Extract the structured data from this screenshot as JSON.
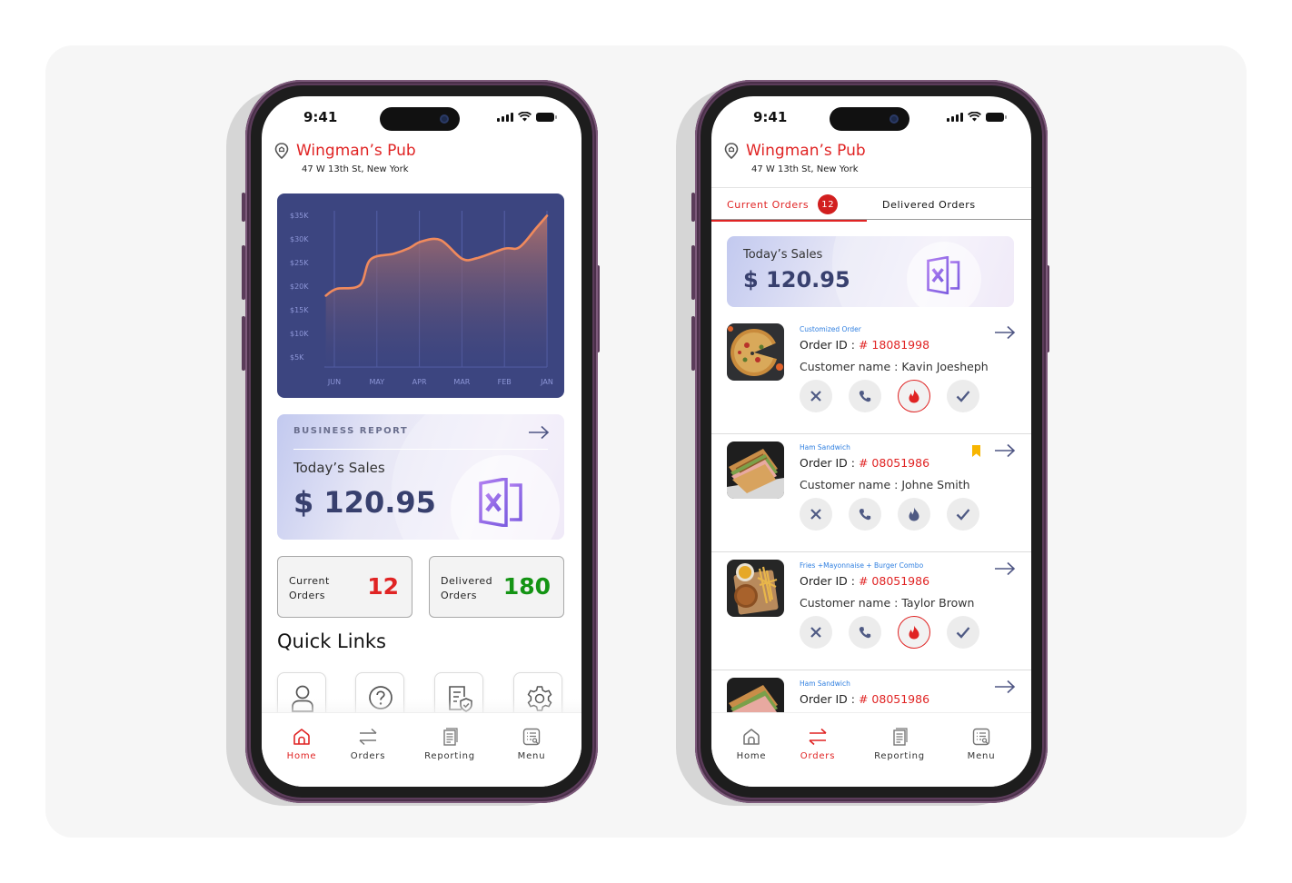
{
  "colors": {
    "brand_red": "#e02424",
    "success_green": "#149414",
    "chart_bg": "#3c4580",
    "chart_line": "#f08a5d",
    "link_blue": "#2f7fe0",
    "bookmark_yellow": "#f7b500",
    "indigo_text": "#38406e"
  },
  "status_bar": {
    "time": "9:41",
    "icons": [
      "signal-icon",
      "wifi-icon",
      "battery-icon"
    ]
  },
  "restaurant": {
    "name": "Wingman’s Pub",
    "address": "47 W 13th St, New York"
  },
  "home_screen": {
    "chart_data": {
      "type": "area",
      "title": "",
      "xlabel": "",
      "ylabel": "",
      "categories": [
        "JUN",
        "MAY",
        "APR",
        "MAR",
        "FEB",
        "JAN"
      ],
      "y_ticks": [
        "$35K",
        "$30K",
        "$25K",
        "$20K",
        "$15K",
        "$10K",
        "$5K"
      ],
      "ylim": [
        0,
        37000
      ],
      "grid": "vertical",
      "series": [
        {
          "name": "Sales",
          "x": [
            -0.2,
            0.05,
            0.6,
            0.85,
            1.4,
            1.75,
            2.05,
            2.5,
            3.0,
            3.35,
            4.0,
            4.35,
            4.75,
            5.0
          ],
          "values": [
            18000,
            19500,
            20300,
            26000,
            27300,
            28500,
            30000,
            30300,
            26200,
            26300,
            28400,
            28700,
            33000,
            35700
          ]
        }
      ]
    },
    "business_report": {
      "title": "BUSINESS REPORT",
      "sublabel": "Today’s Sales",
      "amount": "$ 120.95",
      "icon": "excel-file-icon"
    },
    "stats": [
      {
        "label_line1": "Current",
        "label_line2": "Orders",
        "value": "12",
        "color": "#e02424"
      },
      {
        "label_line1": "Delivered",
        "label_line2": "Orders",
        "value": "180",
        "color": "#149414"
      }
    ],
    "quick_links": {
      "title": "Quick Links",
      "items": [
        {
          "name": "profile",
          "icon": "user-icon"
        },
        {
          "name": "help",
          "icon": "help-circle-icon"
        },
        {
          "name": "policy",
          "icon": "document-shield-icon"
        },
        {
          "name": "settings",
          "icon": "gear-icon"
        }
      ]
    },
    "tab_bar": {
      "active": "Home",
      "items": [
        {
          "label": "Home",
          "icon": "home-icon"
        },
        {
          "label": "Orders",
          "icon": "swap-arrows-icon"
        },
        {
          "label": "Reporting",
          "icon": "documents-icon"
        },
        {
          "label": "Menu",
          "icon": "menu-search-icon"
        }
      ]
    }
  },
  "orders_screen": {
    "tabs": [
      {
        "label": "Current Orders",
        "badge": "12",
        "active": true
      },
      {
        "label": "Delivered Orders",
        "active": false
      }
    ],
    "sales_card": {
      "sublabel": "Today’s Sales",
      "amount": "$ 120.95",
      "icon": "excel-file-icon"
    },
    "order_id_prefix": "Order ID : ",
    "customer_prefix": "Customer name : ",
    "orders": [
      {
        "category": "Customized Order",
        "order_id": "# 18081998",
        "customer": "Kavin Joesheph",
        "image": "pizza",
        "bookmarked": false,
        "priority_active": true
      },
      {
        "category": "Ham Sandwich",
        "order_id": "# 08051986",
        "customer": "Johne Smith",
        "image": "sandwich",
        "bookmarked": true,
        "priority_active": false
      },
      {
        "category": "Fries +Mayonnaise + Burger Combo",
        "order_id": "# 08051986",
        "customer": "Taylor Brown",
        "image": "burger-fries",
        "bookmarked": false,
        "priority_active": true
      },
      {
        "category": "Ham Sandwich",
        "order_id": "# 08051986",
        "customer": "",
        "image": "sandwich",
        "bookmarked": false,
        "priority_active": false
      }
    ],
    "actions": [
      {
        "name": "reject",
        "icon": "close-icon"
      },
      {
        "name": "call",
        "icon": "phone-icon"
      },
      {
        "name": "priority",
        "icon": "flame-icon"
      },
      {
        "name": "accept",
        "icon": "check-icon"
      }
    ],
    "tab_bar": {
      "active": "Orders",
      "items": [
        {
          "label": "Home",
          "icon": "home-icon"
        },
        {
          "label": "Orders",
          "icon": "swap-arrows-icon"
        },
        {
          "label": "Reporting",
          "icon": "documents-icon"
        },
        {
          "label": "Menu",
          "icon": "menu-search-icon"
        }
      ]
    }
  }
}
